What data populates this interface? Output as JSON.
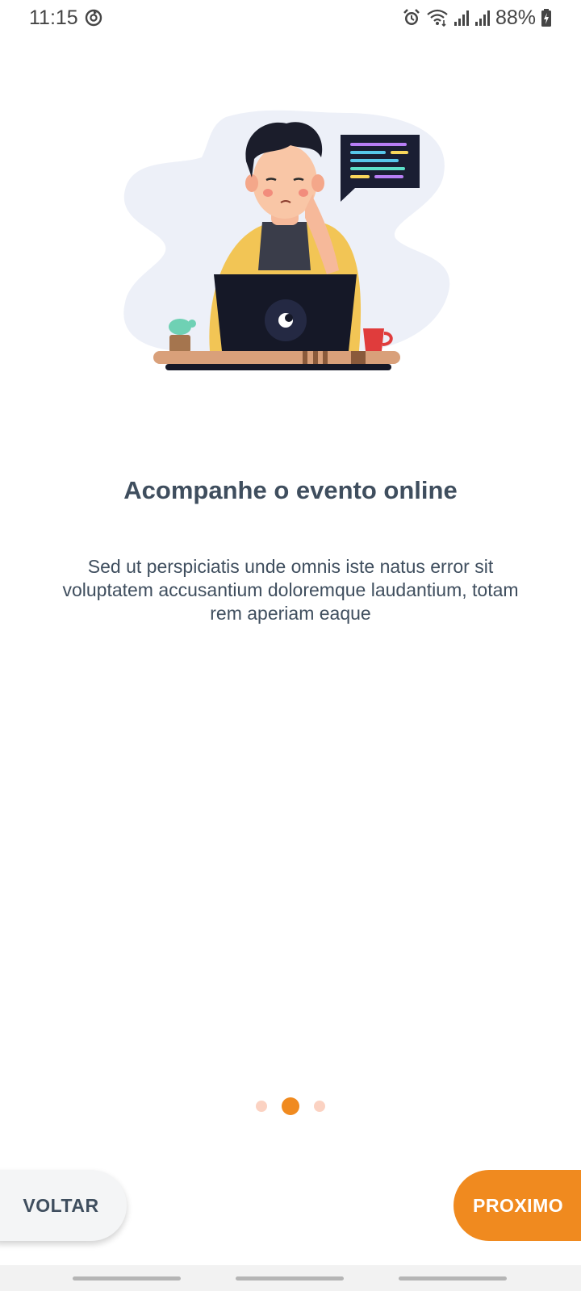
{
  "status_bar": {
    "time": "11:15",
    "battery": "88%",
    "icons": [
      "sync-icon",
      "alarm-icon",
      "wifi-icon",
      "signal-icon",
      "signal-icon",
      "battery-icon"
    ]
  },
  "onboarding": {
    "title": "Acompanhe o evento online",
    "description": "Sed ut perspiciatis unde omnis iste natus error sit voluptatem accusantium doloremque laudantium, totam rem aperiam eaque",
    "page_index": 1,
    "page_count": 3
  },
  "buttons": {
    "back": "VOLTAR",
    "next": "PROXIMO"
  },
  "colors": {
    "accent": "#f08a1f",
    "dot_inactive": "#fbd2c2",
    "text": "#3f4e5e",
    "back_button_bg": "#f4f5f6"
  }
}
